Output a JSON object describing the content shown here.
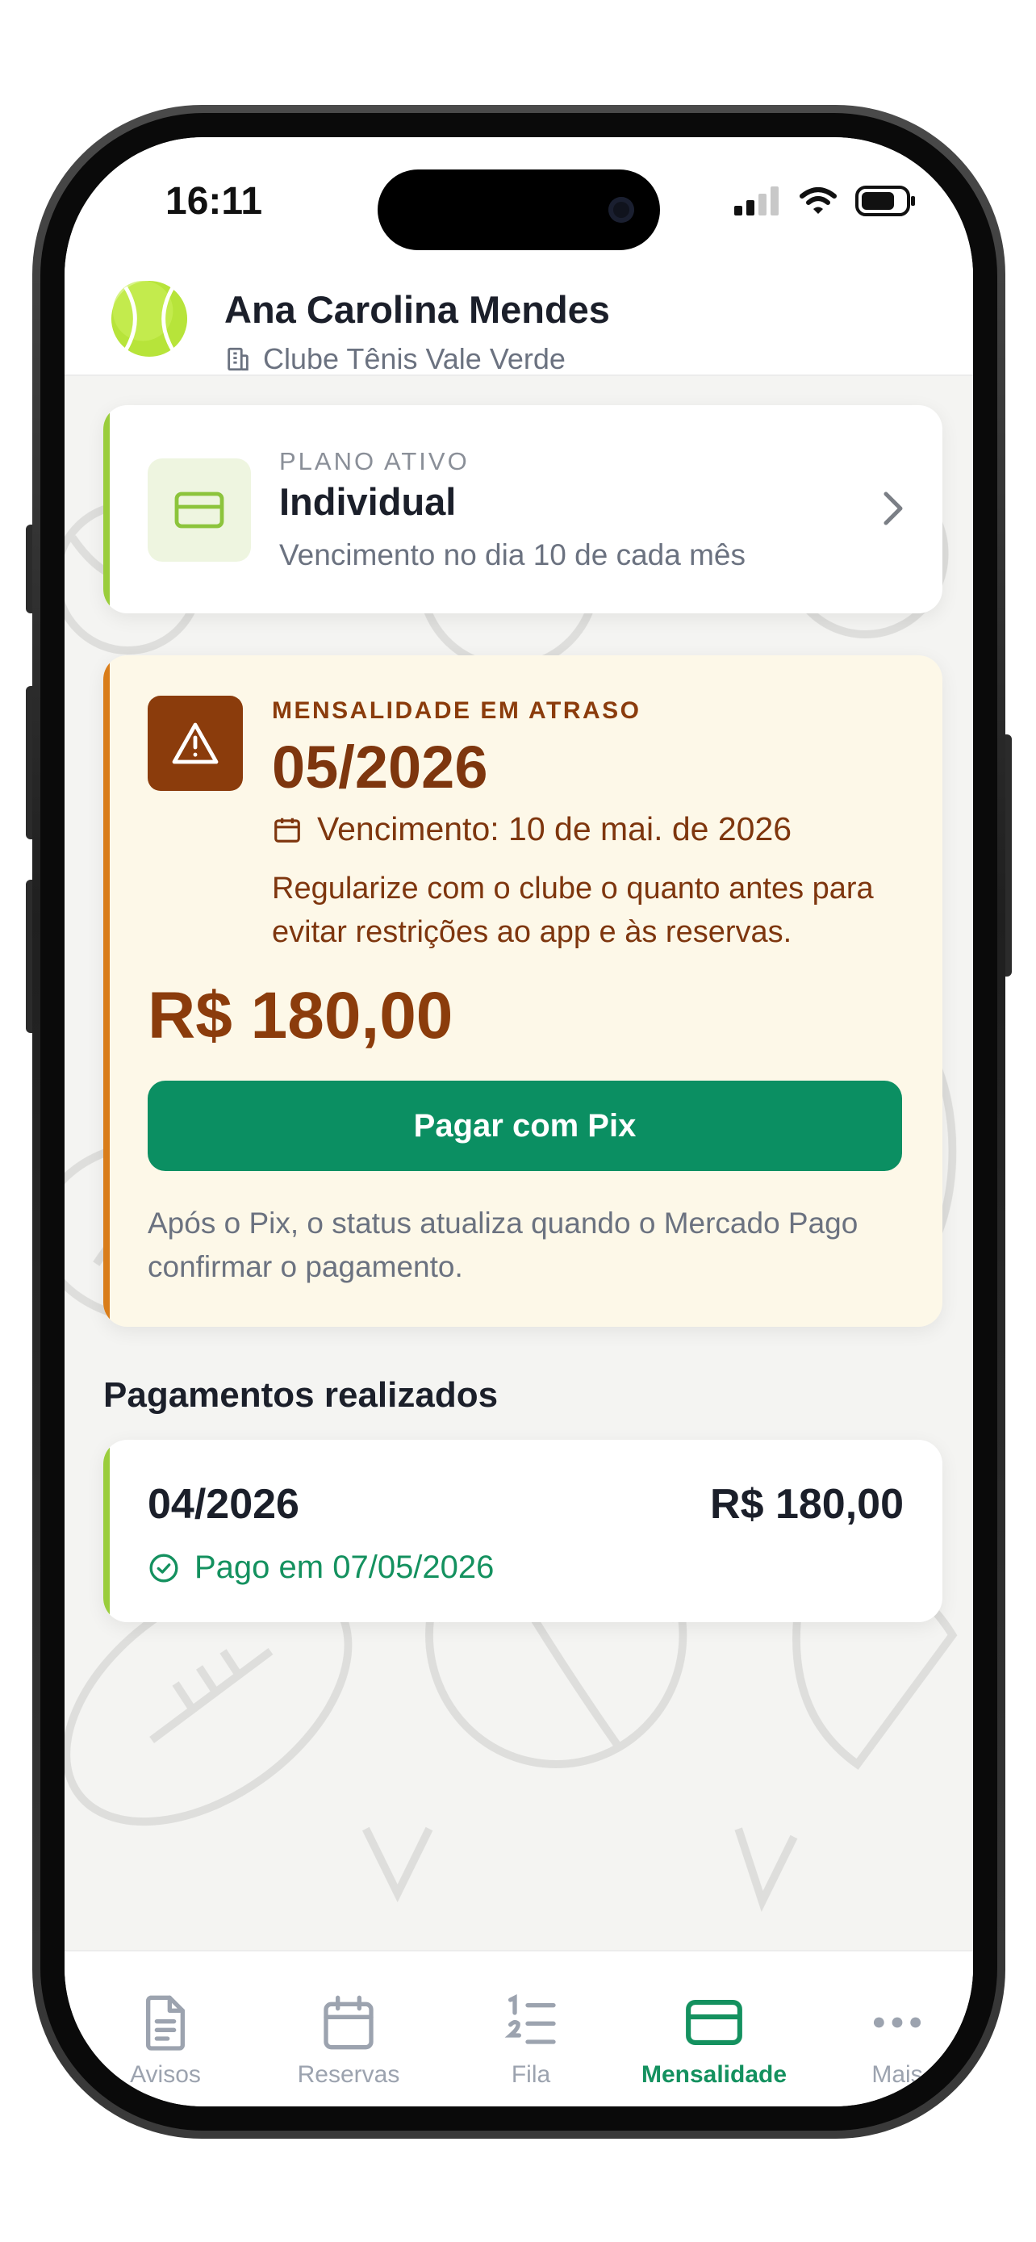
{
  "status_bar": {
    "time": "16:11"
  },
  "header": {
    "user_name": "Ana Carolina Mendes",
    "club_name": "Clube Tênis Vale Verde",
    "avatar_icon": "tennis-ball-icon",
    "club_icon": "building-icon"
  },
  "plan": {
    "kicker": "PLANO ATIVO",
    "name": "Individual",
    "due_text": "Vencimento no dia 10 de cada mês",
    "icon": "credit-card-icon"
  },
  "overdue": {
    "kicker": "MENSALIDADE EM ATRASO",
    "period": "05/2026",
    "due_date": "Vencimento: 10 de mai. de 2026",
    "message": "Regularize com o clube o quanto antes para evitar restrições ao app e às reservas.",
    "amount": "R$ 180,00",
    "pay_button": "Pagar com Pix",
    "note": "Após o Pix, o status atualiza quando o Mercado Pago confirmar o pagamento.",
    "icon": "warning-icon",
    "colors": {
      "accent": "#d97d1a",
      "text": "#7e360e",
      "background": "#fdf8e8",
      "button": "#0b8f62"
    }
  },
  "payments": {
    "section_title": "Pagamentos realizados",
    "items": [
      {
        "period": "04/2026",
        "amount": "R$ 180,00",
        "status": "Pago em 07/05/2026"
      }
    ]
  },
  "tabs": [
    {
      "label": "Avisos",
      "icon": "document-icon",
      "active": false
    },
    {
      "label": "Reservas",
      "icon": "calendar-icon",
      "active": false
    },
    {
      "label": "Fila",
      "icon": "numbered-list-icon",
      "active": false
    },
    {
      "label": "Mensalidade",
      "icon": "credit-card-icon",
      "active": true
    },
    {
      "label": "Mais",
      "icon": "more-icon",
      "active": false
    }
  ],
  "colors": {
    "brand": "#14915f",
    "plan_accent": "#9acd3c"
  }
}
